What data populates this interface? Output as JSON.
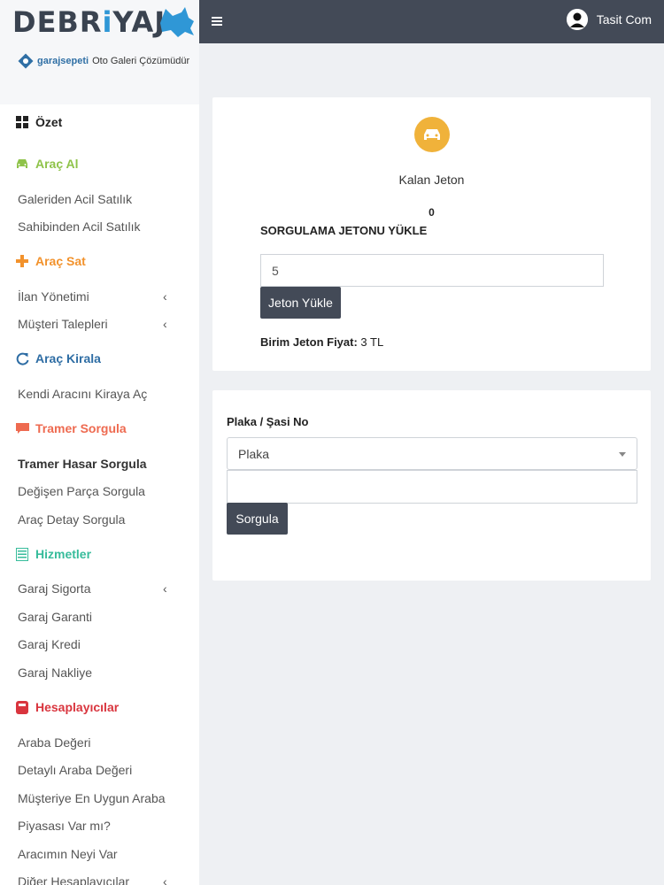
{
  "brand": {
    "title_part1": "DEBR",
    "title_part2": "i",
    "title_part3": "YAJ",
    "sub_brand": "garajsepeti",
    "sub_text": "Oto Galeri Çözümüdür"
  },
  "topbar": {
    "menu_icon": "hamburger-icon",
    "user_name": "Tasit Com"
  },
  "sidebar": {
    "ozet": "Özet",
    "arac_al": {
      "label": "Araç Al",
      "color": "#8fc34a",
      "items": [
        "Galeriden Acil Satılık",
        "Sahibinden Acil Satılık"
      ]
    },
    "arac_sat": {
      "label": "Araç Sat",
      "color": "#f2922c",
      "items": [
        "İlan Yönetimi",
        "Müşteri Talepleri"
      ]
    },
    "arac_kirala": {
      "label": "Araç Kirala",
      "color": "#2e6da4",
      "items": [
        "Kendi Aracını Kiraya Aç"
      ]
    },
    "tramer": {
      "label": "Tramer Sorgula",
      "color": "#ee6a50",
      "items": [
        "Tramer Hasar Sorgula",
        "Değişen Parça Sorgula",
        "Araç Detay Sorgula"
      ]
    },
    "hizmetler": {
      "label": "Hizmetler",
      "color": "#37bc9b",
      "items": [
        "Garaj Sigorta",
        "Garaj Garanti",
        "Garaj Kredi",
        "Garaj Nakliye"
      ]
    },
    "hesap": {
      "label": "Hesaplayıcılar",
      "color": "#d9353e",
      "items": [
        "Araba Değeri",
        "Detaylı Araba Değeri",
        "Müşteriye En Uygun Araba",
        "Piyasası Var mı?",
        "Aracımın Neyi Var",
        "Diğer Hesaplayıcılar"
      ]
    }
  },
  "jeton_card": {
    "kalan_label": "Kalan Jeton",
    "kalan_value": "0",
    "section_title": "SORGULAMA JETONU YÜKLE",
    "input_value": "5",
    "button": "Jeton Yükle",
    "birim_label": "Birim Jeton Fiyat:",
    "birim_value": " 3 TL"
  },
  "plaka_card": {
    "label": "Plaka / Şasi No",
    "select_value": "Plaka",
    "button": "Sorgula"
  }
}
